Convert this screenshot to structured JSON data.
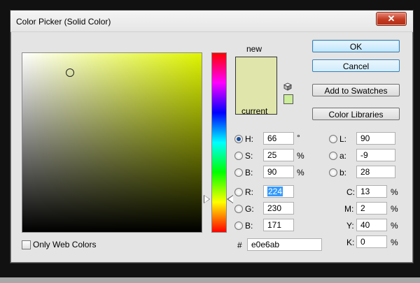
{
  "window": {
    "title": "Color Picker (Solid Color)"
  },
  "swatch": {
    "new_label": "new",
    "current_label": "current",
    "new_color": "#e0e6ab",
    "current_color": "#e0e6ab",
    "websafe_color": "#cced99"
  },
  "buttons": {
    "ok": "OK",
    "cancel": "Cancel",
    "add_to_swatches": "Add to Swatches",
    "color_libraries": "Color Libraries"
  },
  "hsb": {
    "h": {
      "label": "H:",
      "value": "66",
      "unit": "°",
      "selected": true
    },
    "s": {
      "label": "S:",
      "value": "25",
      "unit": "%"
    },
    "b": {
      "label": "B:",
      "value": "90",
      "unit": "%"
    }
  },
  "rgb": {
    "r": {
      "label": "R:",
      "value": "224"
    },
    "g": {
      "label": "G:",
      "value": "230"
    },
    "b": {
      "label": "B:",
      "value": "171"
    }
  },
  "lab": {
    "l": {
      "label": "L:",
      "value": "90"
    },
    "a": {
      "label": "a:",
      "value": "-9"
    },
    "b": {
      "label": "b:",
      "value": "28"
    }
  },
  "cmyk": {
    "c": {
      "label": "C:",
      "value": "13",
      "unit": "%"
    },
    "m": {
      "label": "M:",
      "value": "2",
      "unit": "%"
    },
    "y": {
      "label": "Y:",
      "value": "40",
      "unit": "%"
    },
    "k": {
      "label": "K:",
      "value": "0",
      "unit": "%"
    }
  },
  "hex": {
    "label": "#",
    "value": "e0e6ab"
  },
  "only_web_colors": {
    "label": "Only Web Colors",
    "checked": false
  },
  "colors": {
    "field_hue": "#dff500",
    "accent": "#3399ff"
  }
}
